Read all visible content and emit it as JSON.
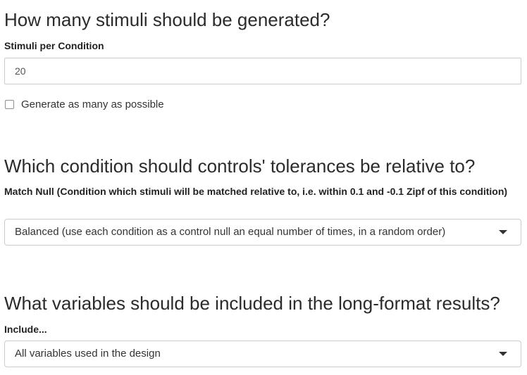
{
  "stimuli_section": {
    "heading": "How many stimuli should be generated?",
    "label": "Stimuli per Condition",
    "value": "20",
    "checkbox_label": "Generate as many as possible",
    "checkbox_checked": false
  },
  "match_section": {
    "heading": "Which condition should controls' tolerances be relative to?",
    "label": "Match Null (Condition which stimuli will be matched relative to, i.e. within 0.1 and -0.1 Zipf of this condition)",
    "selected": "Balanced (use each condition as a control null an equal number of times, in a random order)",
    "icon": "caret-down-icon"
  },
  "include_section": {
    "heading": "What variables should be included in the long-format results?",
    "label": "Include...",
    "selected": "All variables used in the design",
    "icon": "caret-down-icon"
  }
}
